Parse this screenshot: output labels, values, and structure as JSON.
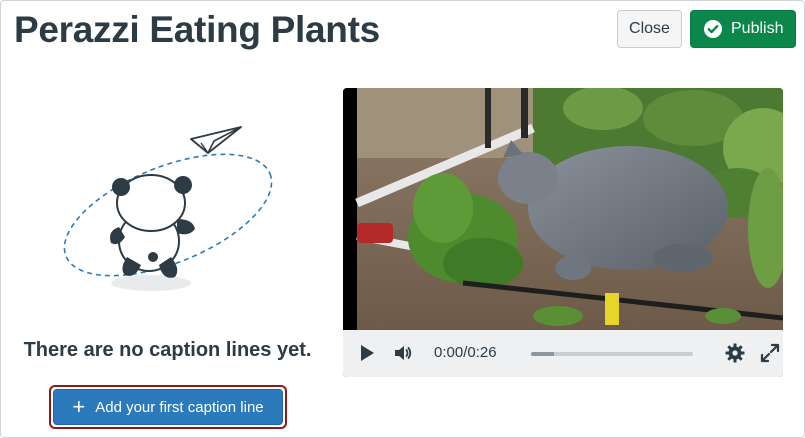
{
  "header": {
    "title": "Perazzi Eating Plants",
    "close_label": "Close",
    "publish_label": "Publish"
  },
  "empty_state": {
    "message": "There are no caption lines yet.",
    "add_button_label": "Add your first caption line"
  },
  "player": {
    "time": "0:00/0:26",
    "progress": 0.0,
    "buffered": 0.14
  },
  "colors": {
    "publish": "#0b874b",
    "add_button": "#2b7abc",
    "focus_ring": "#8b1a1a",
    "text": "#2d3b45"
  },
  "icons": [
    "check-circle-icon",
    "paper-plane-icon",
    "panda-icon",
    "plus-icon",
    "play-icon",
    "volume-icon",
    "gear-icon",
    "fullscreen-icon"
  ]
}
